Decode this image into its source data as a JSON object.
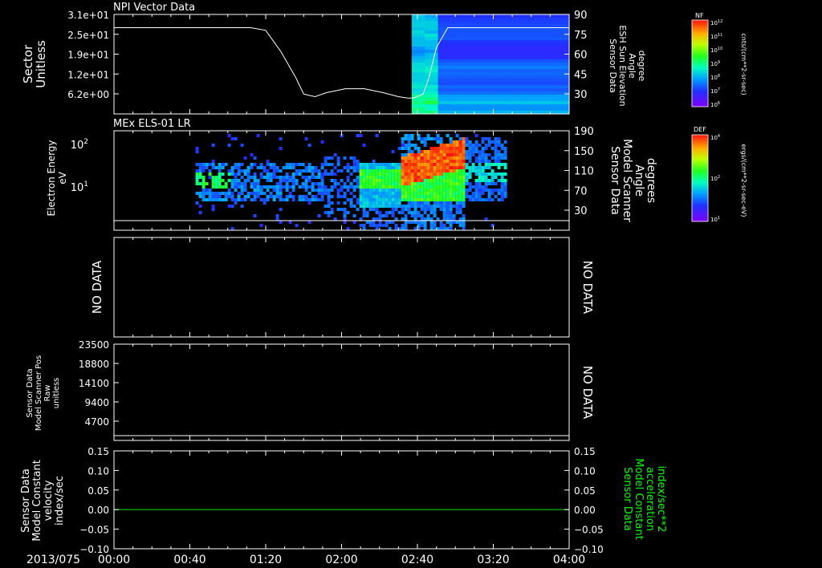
{
  "date_label": "2013/075",
  "time_axis": {
    "ticks": [
      "00:00",
      "00:40",
      "01:20",
      "02:00",
      "02:40",
      "03:20",
      "04:00"
    ],
    "range_minutes": [
      0,
      240
    ]
  },
  "colors": {
    "background": "#000000",
    "axis": "#ffffff",
    "constant_line": "#00cc00",
    "accel_label": "#00ff00"
  },
  "panels": {
    "p1": {
      "title": "NPI Vector Data",
      "ylabel_left": [
        "Sector",
        "Unitless"
      ],
      "yticks_left": [
        "3.1e+01",
        "2.5e+01",
        "1.9e+01",
        "1.2e+01",
        "6.2e+00"
      ],
      "ylabel_right": [
        "Sensor Data",
        "ESH Sun Elevation",
        "Angle",
        "degree"
      ],
      "yticks_right": [
        "90",
        "75",
        "60",
        "45",
        "30"
      ]
    },
    "p2": {
      "title": "MEx ELS-01 LR",
      "ylabel_left": [
        "Electron Energy",
        "eV"
      ],
      "yticks_left": [
        "10",
        "10"
      ],
      "yticks_left_exp": [
        "2",
        "1"
      ],
      "ylabel_right": [
        "Sensor Data",
        "Model Scanner",
        "Angle",
        "degrees"
      ],
      "yticks_right": [
        "190",
        "150",
        "110",
        "70",
        "30"
      ]
    },
    "p3": {
      "no_data_left": "NO DATA",
      "no_data_right": "NO DATA"
    },
    "p4": {
      "ylabel_left": [
        "Sensor Data",
        "Model Scanner Pos",
        "Raw",
        "unitless"
      ],
      "yticks_left": [
        "23500",
        "18800",
        "14100",
        "9400",
        "4700"
      ],
      "no_data_right": "NO DATA"
    },
    "p5": {
      "ylabel_left": [
        "Sensor Data",
        "Model Constant",
        "velocity",
        "index/sec"
      ],
      "yticks_left": [
        "0.15",
        "0.10",
        "0.05",
        "0.00",
        "−0.05",
        "−0.10"
      ],
      "ylabel_right": [
        "Sensor Data",
        "Model Constant",
        "acceleration",
        "index/sec**2"
      ],
      "yticks_right": [
        "0.15",
        "0.10",
        "0.05",
        "0.00",
        "−0.05",
        "−0.10"
      ]
    }
  },
  "colorbars": {
    "nf": {
      "label": "NF",
      "units": "cnts/(cm**2-sr-sec)",
      "tick_base": "10",
      "tick_exps": [
        "12",
        "11",
        "10",
        "9",
        "8",
        "7",
        "6"
      ]
    },
    "def": {
      "label": "DEF",
      "units": "ergs/(cm**2-sr-sec-eV)",
      "tick_base": "10",
      "tick_exps": [
        "4",
        "2",
        "1"
      ]
    }
  },
  "chart_data": [
    {
      "type": "line",
      "panel": "NPI Vector Data",
      "series": [
        {
          "x_minutes": [
            0,
            20,
            40,
            60,
            72,
            80,
            88,
            96,
            100,
            106,
            112,
            122,
            132,
            142,
            150,
            155,
            158,
            163,
            166,
            170,
            176,
            190,
            215,
            240
          ],
          "y": [
            80,
            80,
            80,
            80,
            80,
            78,
            62,
            42,
            30,
            28,
            31,
            34,
            34,
            31,
            28,
            27,
            27,
            30,
            42,
            65,
            80,
            80,
            80,
            80
          ]
        }
      ],
      "y_axis_right_range": [
        15,
        90
      ]
    },
    {
      "type": "heatmap",
      "panel": "NPI Vector Data",
      "x_range_minutes": [
        157,
        240
      ],
      "y_range": [
        20,
        90
      ]
    },
    {
      "type": "heatmap",
      "panel": "MEx ELS-01 LR",
      "x_range_minutes": [
        43,
        207
      ],
      "ylabel": "Electron Energy eV",
      "y_log_range": [
        1,
        150
      ]
    },
    {
      "type": "line",
      "panel": "MEx ELS-01 LR",
      "series": [
        {
          "x_minutes": [
            0,
            240
          ],
          "y": [
            10,
            10
          ]
        }
      ],
      "y_axis_right_range": [
        0,
        190
      ]
    },
    {
      "type": "line",
      "panel": "Sensor Data Model Scanner Pos Raw",
      "series": [
        {
          "x_minutes": [
            0,
            240
          ],
          "y": [
            0,
            0
          ]
        }
      ],
      "ylim": [
        0,
        23500
      ]
    },
    {
      "type": "line",
      "panel": "Sensor Data Model Constant",
      "series": [
        {
          "x_minutes": [
            0,
            240
          ],
          "y": [
            0,
            0
          ]
        }
      ],
      "ylim": [
        -0.1,
        0.15
      ]
    }
  ]
}
